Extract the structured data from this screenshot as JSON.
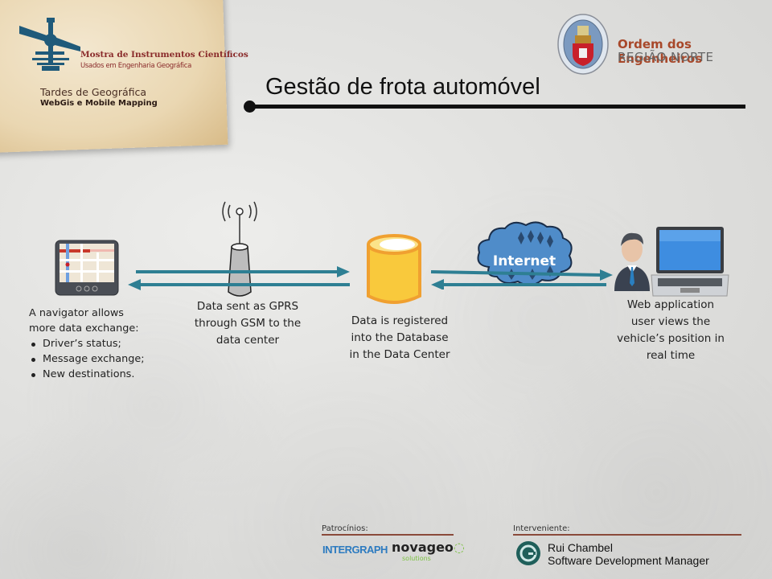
{
  "header": {
    "left_logo": {
      "title": "Mostra de Instrumentos Científicos",
      "subtitle": "Usados em Engenharia Geográfica",
      "event_title": "Tardes de Geográfica",
      "event_subtitle": "WebGis e Mobile Mapping",
      "icon": "theodolite-icon"
    },
    "right_logo": {
      "title": "Ordem dos Engenheiros",
      "subtitle": "REGIÃO NORTE",
      "icon": "coat-of-arms-icon"
    },
    "page_title": "Gestão de frota automóvel"
  },
  "diagram": {
    "nodes": [
      {
        "id": "navigator",
        "icon": "gps-navigator-icon",
        "caption_intro": [
          "A navigator allows",
          "more data exchange:"
        ],
        "bullets": [
          "Driver’s status;",
          "Message exchange;",
          "New destinations."
        ]
      },
      {
        "id": "gsm-tower",
        "icon": "antenna-tower-icon",
        "caption": [
          "Data sent as GPRS",
          "through GSM to the",
          "data center"
        ]
      },
      {
        "id": "database",
        "icon": "database-icon",
        "caption": [
          "Data is registered",
          "into the Database",
          "in the Data Center"
        ]
      },
      {
        "id": "internet",
        "icon": "cloud-icon",
        "label": "Internet"
      },
      {
        "id": "web-user",
        "icon": "user-laptop-icon",
        "caption": [
          "Web application",
          "user views the",
          "vehicle’s position in",
          "real time"
        ]
      }
    ],
    "links": [
      {
        "from": "navigator",
        "to": "database",
        "direction": "bidirectional"
      },
      {
        "from": "database",
        "to": "web-user",
        "direction": "bidirectional"
      }
    ],
    "colors": {
      "arrow": "#2e7f93",
      "database_fill": "#f9c93c",
      "database_stroke": "#f0a030",
      "cloud": "#4f8cc9",
      "tower": "#bdbdbd"
    }
  },
  "footer": {
    "sponsors_label": "Patrocínios:",
    "sponsors": [
      "INTERGRAPH",
      "novageo",
      "solutions"
    ],
    "intervener_label": "Interveniente:",
    "presenter_name": "Rui Chambel",
    "presenter_role": "Software Development Manager",
    "presenter_logo_letter": "G"
  }
}
